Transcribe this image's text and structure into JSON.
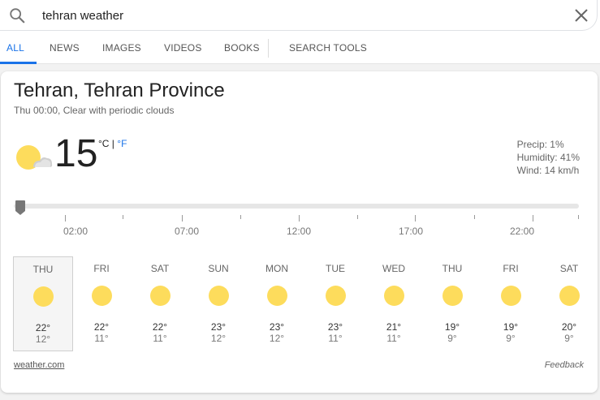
{
  "search": {
    "query": "tehran weather"
  },
  "tabs": [
    {
      "label": "ALL",
      "active": true
    },
    {
      "label": "NEWS"
    },
    {
      "label": "IMAGES"
    },
    {
      "label": "VIDEOS"
    },
    {
      "label": "BOOKS"
    },
    {
      "label": "SEARCH TOOLS"
    }
  ],
  "weather": {
    "location": "Tehran, Tehran Province",
    "subtitle": "Thu 00:00, Clear with periodic clouds",
    "current_icon": "sun-behind-cloud-icon",
    "temperature": "15",
    "unit_c": "°C",
    "unit_sep": " | ",
    "unit_f": "°F",
    "precip": "Precip: 1%",
    "humidity": "Humidity: 41%",
    "wind": "Wind: 14 km/h",
    "time_labels": [
      "02:00",
      "07:00",
      "12:00",
      "17:00",
      "22:00"
    ],
    "forecast": [
      {
        "day": "THU",
        "hi": "22°",
        "lo": "12°",
        "icon": "sun-icon",
        "selected": true
      },
      {
        "day": "FRI",
        "hi": "22°",
        "lo": "11°",
        "icon": "sun-icon"
      },
      {
        "day": "SAT",
        "hi": "22°",
        "lo": "11°",
        "icon": "sun-icon"
      },
      {
        "day": "SUN",
        "hi": "23°",
        "lo": "12°",
        "icon": "sun-icon"
      },
      {
        "day": "MON",
        "hi": "23°",
        "lo": "12°",
        "icon": "sun-icon"
      },
      {
        "day": "TUE",
        "hi": "23°",
        "lo": "11°",
        "icon": "sun-icon"
      },
      {
        "day": "WED",
        "hi": "21°",
        "lo": "11°",
        "icon": "sun-icon"
      },
      {
        "day": "THU",
        "hi": "19°",
        "lo": "9°",
        "icon": "sun-icon"
      },
      {
        "day": "FRI",
        "hi": "19°",
        "lo": "9°",
        "icon": "sun-icon"
      },
      {
        "day": "SAT",
        "hi": "20°",
        "lo": "9°",
        "icon": "sun-icon"
      }
    ],
    "source": "weather.com",
    "feedback": "Feedback"
  },
  "colors": {
    "accent": "#1a73e8",
    "sun": "#fddc5c"
  }
}
